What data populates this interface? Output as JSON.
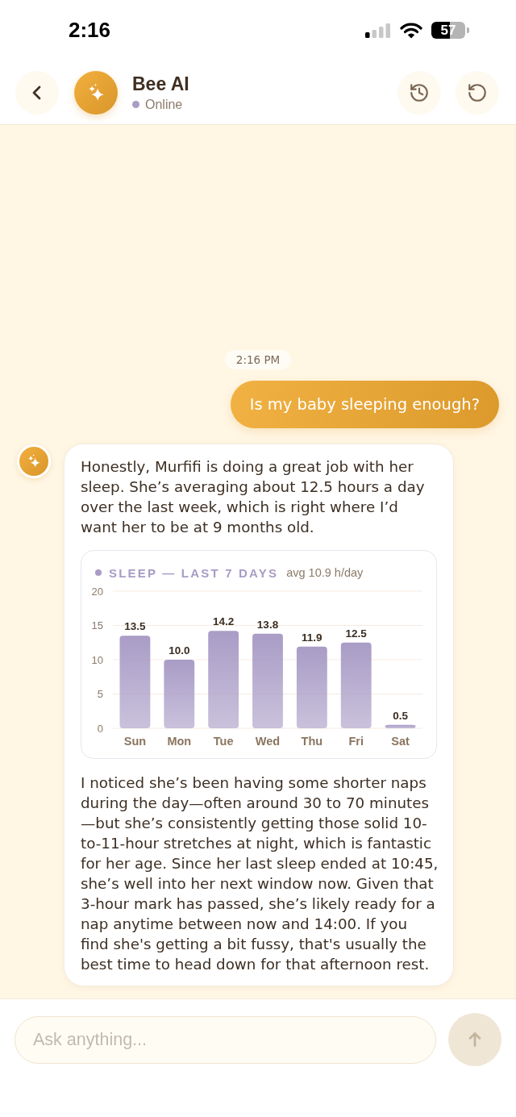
{
  "status_bar": {
    "time": "2:16",
    "battery": "57"
  },
  "header": {
    "title": "Bee AI",
    "status": "Online"
  },
  "messages": [
    {
      "kind": "timestamp",
      "text": "2:16 PM"
    },
    {
      "kind": "user",
      "text": "Is my baby sleeping enough?"
    },
    {
      "kind": "bot",
      "blocks": [
        {
          "kind": "text",
          "text": "Honestly, Murfifi is doing a great job with her sleep. She’s averaging about 12.5 hours a day over the last week, which is right where I’d want her to be at 9 months old."
        },
        {
          "kind": "chart",
          "average": "avg 10.9 h/day",
          "chart_data": {
            "type": "bar",
            "title": "SLEEP — LAST 7 DAYS",
            "categories": [
              "Sun",
              "Mon",
              "Tue",
              "Wed",
              "Thu",
              "Fri",
              "Sat"
            ],
            "series": [
              {
                "color": "#a99cc6",
                "values": [
                  13.5,
                  10.0,
                  14.2,
                  13.8,
                  11.9,
                  12.5,
                  0.5
                ]
              }
            ],
            "ylim": [
              0,
              20
            ],
            "yticks": [
              0,
              5,
              10,
              15,
              20
            ],
            "grid": true,
            "value_labels": [
              "13.5",
              "10.0",
              "14.2",
              "13.8",
              "11.9",
              "12.5",
              "0.5"
            ]
          }
        },
        {
          "kind": "text",
          "text": "I noticed she’s been having some shorter naps during the day—often around 30 to 70 minutes—but she’s consistently getting those solid 10-to-11-hour stretches at night, which is fantastic for her age. Since her last sleep ended at 10:45, she’s well into her next window now. Given that 3-hour mark has passed, she’s likely ready for a nap anytime between now and 14:00. If you find she's getting a bit fussy, that's usually the best time to head down for that afternoon rest."
        }
      ]
    }
  ],
  "composer": {
    "placeholder": "Ask anything...",
    "send_disabled": true
  }
}
